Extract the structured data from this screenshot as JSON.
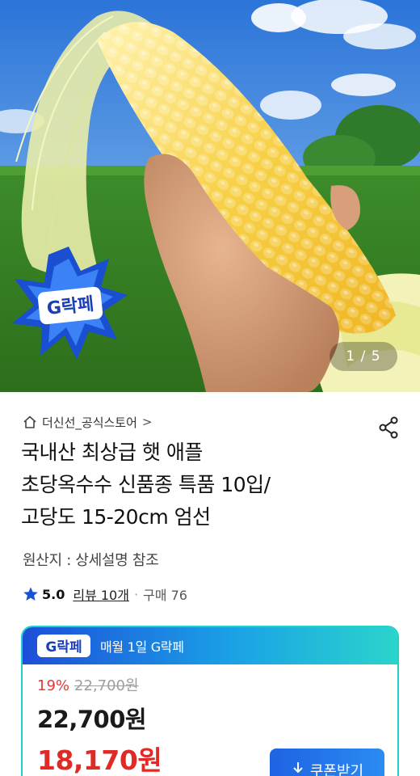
{
  "hero": {
    "page_indicator": "1 / 5",
    "badge_text": "G락페"
  },
  "store": {
    "home_icon": "home-icon",
    "name": "더신선_공식스토어",
    "chevron": ">",
    "share_icon": "share-icon"
  },
  "product": {
    "title_lines": [
      "국내산 최상급 햇 애플",
      "초당옥수수 신품종 특품 10입/",
      "고당도 15-20cm 엄선"
    ],
    "origin": "원산지 : 상세설명 참조"
  },
  "rating": {
    "star_icon": "star-icon",
    "score": "5.0",
    "reviews": "리뷰 10개",
    "separator": "·",
    "sales": "구매 76"
  },
  "price_card": {
    "logo_text": "G락페",
    "header_text": "매월 1일 G락페",
    "discount_rate": "19%",
    "original_price": "22,700원",
    "sale_price": "22,700원",
    "coupon_price": "18,170원",
    "coupon_button": "쿠폰받기",
    "coupon_icon": "download-icon"
  },
  "colors": {
    "accent_red": "#e02a26",
    "accent_blue": "#1e63e3",
    "card_border": "#1fd1c9",
    "star": "#1a4fd6"
  }
}
